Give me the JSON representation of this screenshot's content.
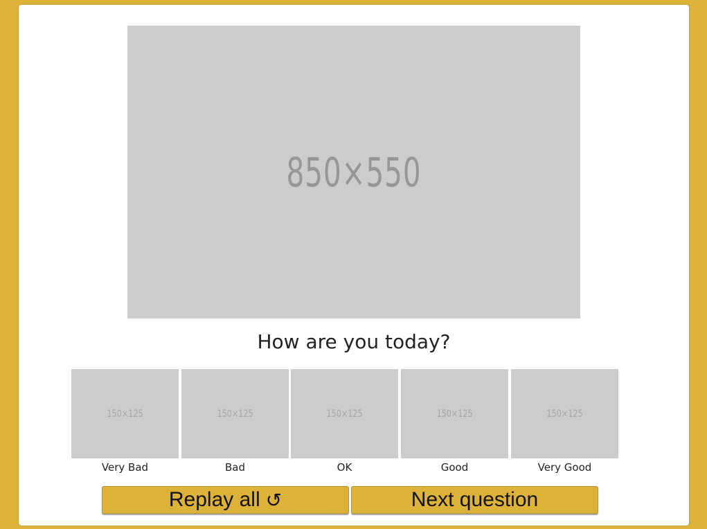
{
  "hero": {
    "placeholder_text": "850×550"
  },
  "question": "How are you today?",
  "options": [
    {
      "placeholder_text": "150×125",
      "label": "Very Bad"
    },
    {
      "placeholder_text": "150×125",
      "label": "Bad"
    },
    {
      "placeholder_text": "150×125",
      "label": "OK"
    },
    {
      "placeholder_text": "150×125",
      "label": "Good"
    },
    {
      "placeholder_text": "150×125",
      "label": "Very Good"
    }
  ],
  "buttons": {
    "replay_label": "Replay all",
    "replay_icon": "↺",
    "next_label": "Next question"
  },
  "colors": {
    "accent": "#dcb239",
    "placeholder": "#cccccc"
  }
}
